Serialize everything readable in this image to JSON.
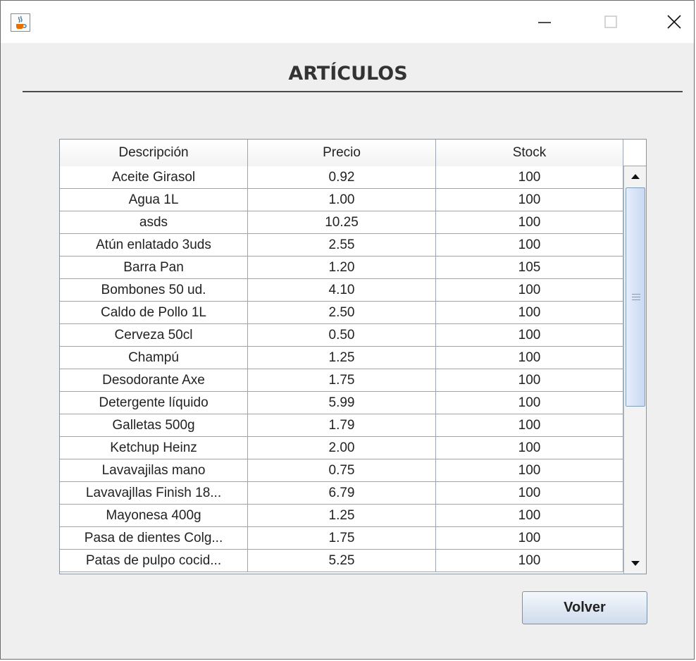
{
  "window": {
    "icon": "java-cup-icon",
    "controls": [
      "minimize-icon",
      "maximize-icon",
      "close-icon"
    ]
  },
  "page": {
    "title": "ARTÍCULOS"
  },
  "table": {
    "columns": [
      "Descripción",
      "Precio",
      "Stock"
    ],
    "rows": [
      [
        "Aceite Girasol",
        "0.92",
        "100"
      ],
      [
        "Agua 1L",
        "1.00",
        "100"
      ],
      [
        "asds",
        "10.25",
        "100"
      ],
      [
        "Atún enlatado 3uds",
        "2.55",
        "100"
      ],
      [
        "Barra Pan",
        "1.20",
        "105"
      ],
      [
        "Bombones 50 ud.",
        "4.10",
        "100"
      ],
      [
        "Caldo de Pollo 1L",
        "2.50",
        "100"
      ],
      [
        "Cerveza 50cl",
        "0.50",
        "100"
      ],
      [
        "Champú",
        "1.25",
        "100"
      ],
      [
        "Desodorante Axe",
        "1.75",
        "100"
      ],
      [
        "Detergente líquido",
        "5.99",
        "100"
      ],
      [
        "Galletas 500g",
        "1.79",
        "100"
      ],
      [
        "Ketchup Heinz",
        "2.00",
        "100"
      ],
      [
        "Lavavajilas mano",
        "0.75",
        "100"
      ],
      [
        "Lavavajllas Finish 18...",
        "6.79",
        "100"
      ],
      [
        "Mayonesa 400g",
        "1.25",
        "100"
      ],
      [
        "Pasa de dientes Colg...",
        "1.75",
        "100"
      ],
      [
        "Patas de pulpo cocid...",
        "5.25",
        "100"
      ]
    ],
    "scroll": {
      "thumb_start": 0.0,
      "thumb_fraction": 0.6
    }
  },
  "actions": {
    "back_label": "Volver"
  }
}
